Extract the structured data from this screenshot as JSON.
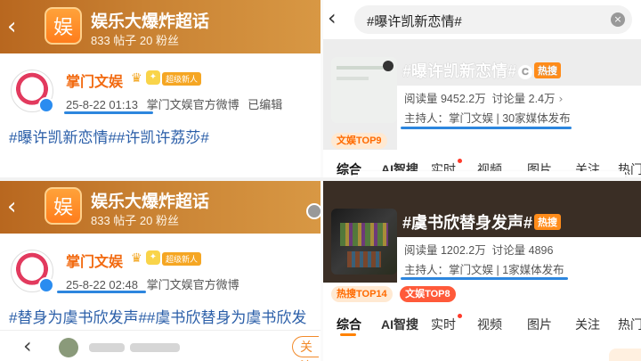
{
  "top_left": {
    "topic": {
      "logo_char": "娱",
      "title": "娱乐大爆炸超话",
      "stats": "833 帖子 20 粉丝"
    },
    "post": {
      "author": "掌门文娱",
      "badge": "超级新人",
      "date": "25-8-22 01:13",
      "source": "掌门文娱官方微博",
      "edited": "已编辑",
      "text": "#曝许凯新恋情##许凯许荔莎#"
    }
  },
  "bottom_left": {
    "topic": {
      "logo_char": "娱",
      "title": "娱乐大爆炸超话",
      "stats": "833 帖子 20 粉丝"
    },
    "post": {
      "author": "掌门文娱",
      "badge": "超级新人",
      "date": "25-8-22 02:48",
      "source": "掌门文娱官方微博",
      "text": "#替身为虞书欣发声##虞书欣替身为虞书欣发"
    },
    "nav": {
      "back": "‹",
      "follow_label": "关注"
    }
  },
  "top_right": {
    "search": {
      "query": "#曝许凯新恋情#",
      "clear": "×"
    },
    "topic_name": "#曝许凯新恋情#",
    "hot_label": "热搜",
    "reads": "阅读量 9452.2万",
    "discussions": "讨论量 2.4万",
    "host": "主持人：掌门文娱",
    "media": "30家媒体发布",
    "rank_tags": [
      "文娱TOP9"
    ],
    "tabs": [
      "综合",
      "AI智搜",
      "实时",
      "视频",
      "图片",
      "关注",
      "热门"
    ]
  },
  "bottom_right": {
    "topic_name": "#虞书欣替身发声#",
    "hot_label": "热搜",
    "reads": "阅读量 1202.2万",
    "discussions": "讨论量 4896",
    "host": "主持人：掌门文娱",
    "media": "1家媒体发布",
    "rank_tags": [
      "热搜TOP14",
      "文娱TOP8"
    ],
    "tabs": [
      "综合",
      "AI智搜",
      "实时",
      "视频",
      "图片",
      "关注",
      "热门"
    ]
  },
  "icons": {
    "back": "chevron-left-icon",
    "crown": "crown-icon",
    "clear": "clear-icon",
    "verified": "verified-icon"
  },
  "colors": {
    "header_brown": "#c98233",
    "author_orange": "#f26a10",
    "topic_link_blue": "#2a5ea8",
    "underline_blue": "#2d86de",
    "hot_orange": "#ff8c1a"
  }
}
